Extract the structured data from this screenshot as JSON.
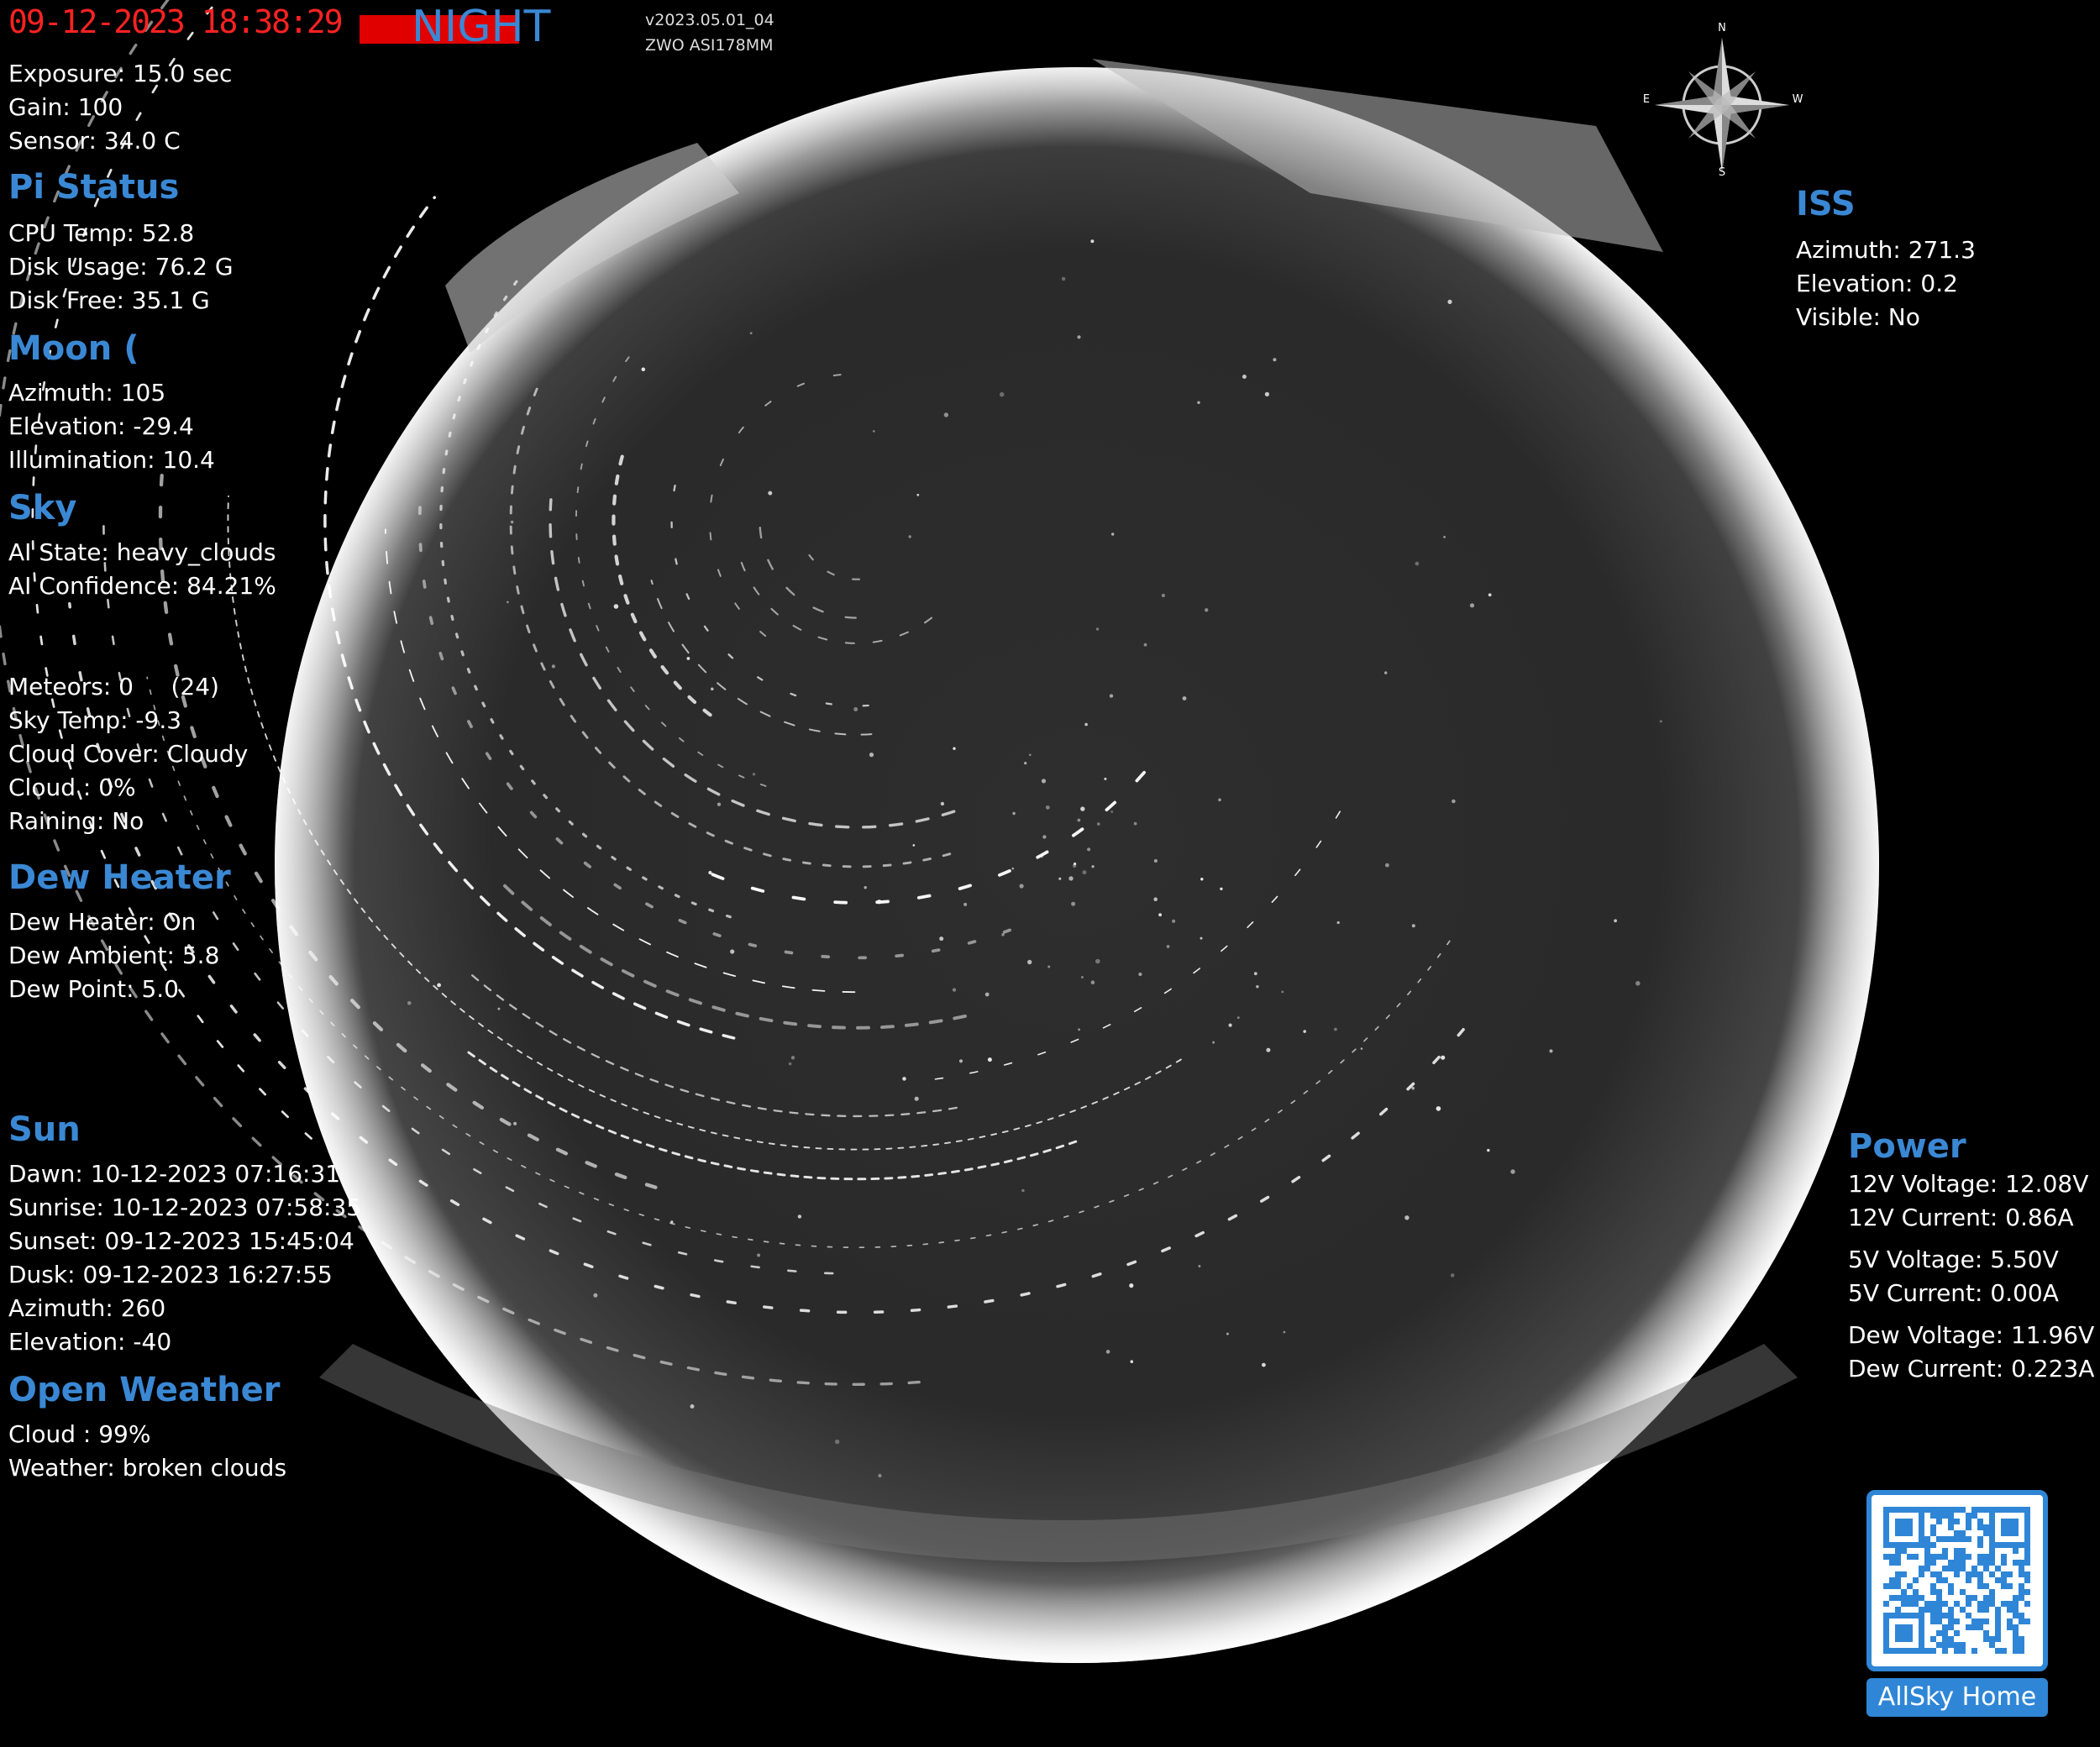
{
  "header": {
    "timestamp": "09-12-2023 18:38:29",
    "period": "NIGHT",
    "version": "v2023.05.01_04",
    "camera": "ZWO ASI178MM"
  },
  "camera": {
    "exposure": "Exposure: 15.0 sec",
    "gain_label": "Gain: ",
    "gain_value": "100",
    "sensor_label": "Sensor: ",
    "sensor_value": "34.0 C"
  },
  "pi_status": {
    "title": "Pi Status",
    "cpu_label": "CPU Temp: ",
    "cpu_value": "52.8",
    "disk_usage_label": "Disk Usage: ",
    "disk_usage_value": "76.2 G",
    "disk_free_label": "Disk Free: ",
    "disk_free_value": "35.1 G"
  },
  "moon": {
    "title": "Moon",
    "phase_icon": "(",
    "azimuth_label": "Azimuth: ",
    "azimuth_value": "105",
    "elevation_label": "Elevation: ",
    "elevation_value": "-29.4",
    "illumination_label": "Illumination: ",
    "illumination_value": "10.4"
  },
  "sky": {
    "title": "Sky",
    "ai_state_label": "AI State: ",
    "ai_state_value": "heavy_clouds",
    "ai_confidence_label": "AI Confidence: ",
    "ai_confidence_value": "84.21%",
    "meteors_label": "Meteors: ",
    "meteors_value": "0",
    "meteors_extra": "(24)",
    "sky_temp_label": "Sky Temp: ",
    "sky_temp_value": "-9.3",
    "cloud_cover_label": "Cloud Cover: ",
    "cloud_cover_value": "Cloudy",
    "cloud": "Cloud : 0%",
    "raining": "Raining: No"
  },
  "dew_heater": {
    "title": "Dew Heater",
    "status": "Dew Heater: On",
    "ambient_label": "Dew Ambient: ",
    "ambient_value": "5.8",
    "point_label": "Dew Point: ",
    "point_value": "5.0"
  },
  "sun": {
    "title": "Sun",
    "dawn_label": "Dawn: ",
    "dawn_value": "10-12-2023 07:16:31",
    "sunrise_label": "Sunrise: ",
    "sunrise_value": "10-12-2023 07:58:35",
    "sunset_label": "Sunset: ",
    "sunset_value": "09-12-2023 15:45:04",
    "dusk_label": "Dusk: ",
    "dusk_value": "09-12-2023 16:27:55",
    "azimuth_label": "Azimuth: ",
    "azimuth_value": "260",
    "elevation_label": "Elevation: ",
    "elevation_value": "-40"
  },
  "open_weather": {
    "title": "Open Weather",
    "cloud_label": "Cloud : ",
    "cloud_value": "99%",
    "weather_label": "Weather: ",
    "weather_value": "broken clouds"
  },
  "compass": {
    "n": "N",
    "s": "S",
    "e": "E",
    "w": "W"
  },
  "iss": {
    "title": "ISS",
    "azimuth_label": "Azimuth: ",
    "azimuth_value": "271.3",
    "elevation_label": "Elevation: ",
    "elevation_value": "0.2",
    "visible": "Visible: No"
  },
  "power": {
    "title": "Power",
    "v12_label": "12V Voltage: ",
    "v12_value": "12.08V",
    "c12_label": "12V Current: ",
    "c12_value": "0.86A",
    "v5_label": "5V Voltage: ",
    "v5_value": "5.50V",
    "c5_label": "5V Current: ",
    "c5_value": "0.00A",
    "dewv_label": "Dew Voltage: ",
    "dewv_value": "11.96V",
    "dewc_label": "Dew Current: ",
    "dewc_value": "0.223A"
  },
  "qr": {
    "button_label": "AllSky Home"
  }
}
